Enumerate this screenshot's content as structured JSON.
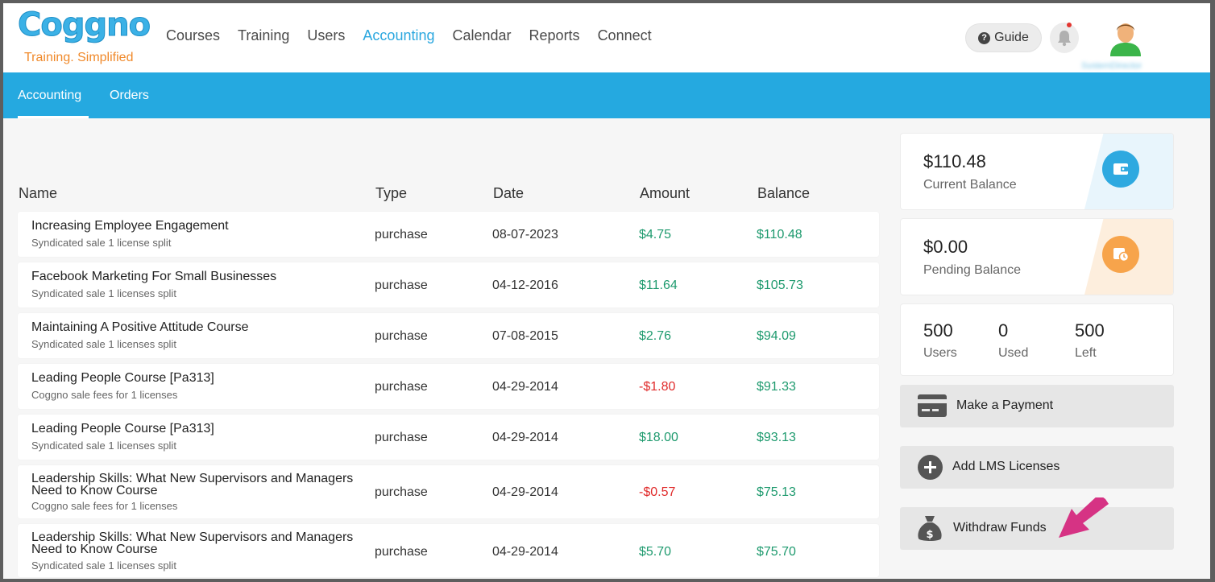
{
  "brand": {
    "name": "Coggno",
    "tagline": "Training. Simplified"
  },
  "main_nav": {
    "items": [
      "Courses",
      "Training",
      "Users",
      "Accounting",
      "Calendar",
      "Reports",
      "Connect"
    ],
    "active": "Accounting"
  },
  "header": {
    "guide_label": "Guide",
    "user_name": "SystemDirector"
  },
  "sub_nav": {
    "items": [
      "Accounting",
      "Orders"
    ],
    "active": "Accounting"
  },
  "table": {
    "columns": [
      "Name",
      "Type",
      "Date",
      "Amount",
      "Balance"
    ],
    "rows": [
      {
        "name": "Increasing Employee Engagement",
        "sub": "Syndicated sale 1 license split",
        "type": "purchase",
        "date": "08-07-2023",
        "amount": "$4.75",
        "amount_sign": "positive",
        "balance": "$110.48"
      },
      {
        "name": "Facebook Marketing For Small Businesses",
        "sub": "Syndicated sale 1 licenses split",
        "type": "purchase",
        "date": "04-12-2016",
        "amount": "$11.64",
        "amount_sign": "positive",
        "balance": "$105.73"
      },
      {
        "name": "Maintaining A Positive Attitude Course",
        "sub": "Syndicated sale 1 licenses split",
        "type": "purchase",
        "date": "07-08-2015",
        "amount": "$2.76",
        "amount_sign": "positive",
        "balance": "$94.09"
      },
      {
        "name": "Leading People Course [Pa313]",
        "sub": "Coggno sale fees for 1 licenses",
        "type": "purchase",
        "date": "04-29-2014",
        "amount": "-$1.80",
        "amount_sign": "negative",
        "balance": "$91.33"
      },
      {
        "name": "Leading People Course [Pa313]",
        "sub": "Syndicated sale 1 licenses split",
        "type": "purchase",
        "date": "04-29-2014",
        "amount": "$18.00",
        "amount_sign": "positive",
        "balance": "$93.13"
      },
      {
        "name": "Leadership Skills: What New Supervisors and Managers Need to Know Course",
        "sub": "Coggno sale fees for 1 licenses",
        "type": "purchase",
        "date": "04-29-2014",
        "amount": "-$0.57",
        "amount_sign": "negative",
        "balance": "$75.13"
      },
      {
        "name": "Leadership Skills: What New Supervisors and Managers Need to Know Course",
        "sub": "Syndicated sale 1 licenses split",
        "type": "purchase",
        "date": "04-29-2014",
        "amount": "$5.70",
        "amount_sign": "positive",
        "balance": "$75.70"
      }
    ]
  },
  "summary": {
    "current_balance": {
      "value": "$110.48",
      "label": "Current Balance"
    },
    "pending_balance": {
      "value": "$0.00",
      "label": "Pending Balance"
    },
    "licenses": [
      {
        "value": "500",
        "label": "Users"
      },
      {
        "value": "0",
        "label": "Used"
      },
      {
        "value": "500",
        "label": "Left"
      }
    ]
  },
  "actions": {
    "make_payment": "Make a Payment",
    "add_licenses": "Add LMS Licenses",
    "withdraw_funds": "Withdraw Funds"
  },
  "colors": {
    "accent": "#25a9e0",
    "positive": "#1e9a6e",
    "negative": "#e02a2a",
    "annotation_arrow": "#d63384"
  }
}
